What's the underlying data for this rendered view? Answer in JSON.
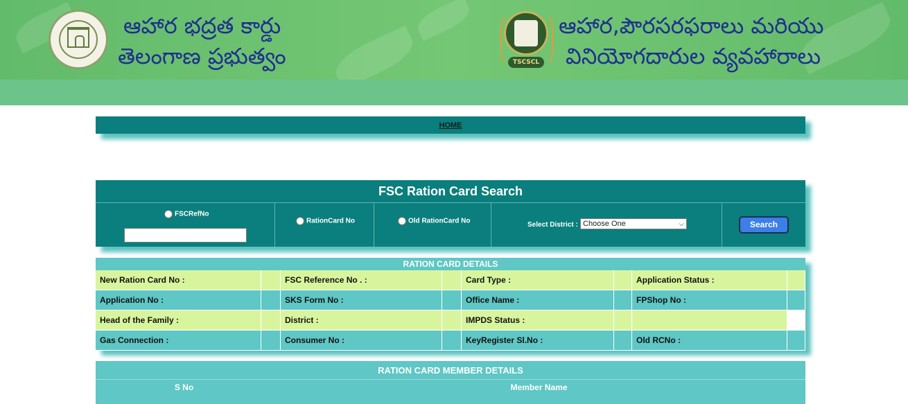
{
  "header": {
    "left_title_line1": "ఆహార భద్రత కార్డు",
    "left_title_line2": "తెలంగాణ ప్రభుత్వం",
    "right_title_line1": "ఆహార,పౌరసరఫరాలు మరియు",
    "right_title_line2": "వినియోగదారుల వ్యవహారాలు",
    "right_logo_badge": "TSCSCL"
  },
  "nav": {
    "home": "HOME"
  },
  "search": {
    "title": "FSC Ration Card Search",
    "options": [
      "FSCRefNo",
      "RationCard No",
      "Old RationCard No"
    ],
    "district_label": "Select District :",
    "district_value": "Choose One",
    "button": "Search"
  },
  "details": {
    "title": "RATION CARD DETAILS",
    "rows": [
      [
        "New Ration Card No :",
        "",
        "FSC Reference No . :",
        "",
        "Card Type :",
        "",
        "Application Status :",
        ""
      ],
      [
        "Application No :",
        "",
        "SKS Form No :",
        "",
        "Office Name :",
        "",
        "FPShop No :",
        ""
      ],
      [
        "Head of the Family :",
        "",
        "District :",
        "",
        "IMPDS Status :",
        "",
        "",
        ""
      ],
      [
        "Gas Connection :",
        "",
        "Consumer No :",
        "",
        "KeyRegister Sl.No :",
        "",
        "Old RCNo :",
        ""
      ]
    ]
  },
  "members": {
    "title": "RATION CARD MEMBER DETAILS",
    "columns": [
      "S No",
      "Member Name"
    ]
  },
  "colors": {
    "header_green": "#6cc47a",
    "panel_teal": "#0a7f7d",
    "details_teal": "#5fc7c5",
    "details_lime": "#d8f59d",
    "title_blue": "#1f2f8f",
    "button_blue": "#3c7fe6"
  }
}
